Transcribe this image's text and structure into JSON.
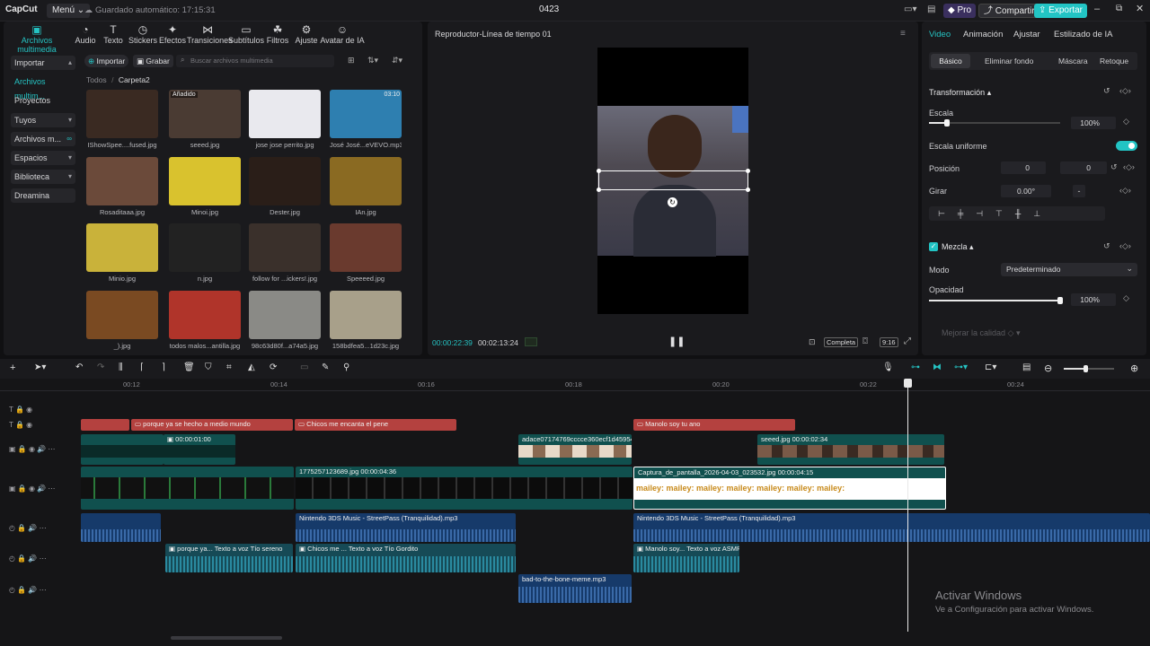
{
  "titlebar": {
    "logo": "CapCut",
    "menu": "Menú",
    "autosave": "Guardado automático: 17:15:31",
    "project": "0423",
    "pro": "Pro",
    "share": "Compartir",
    "export": "Exportar"
  },
  "tools": [
    {
      "label": "Archivos multimedia",
      "icon": "media-icon"
    },
    {
      "label": "Audio",
      "icon": "audio-icon"
    },
    {
      "label": "Texto",
      "icon": "text-icon"
    },
    {
      "label": "Stickers",
      "icon": "sticker-icon"
    },
    {
      "label": "Efectos",
      "icon": "effects-icon"
    },
    {
      "label": "Transiciones",
      "icon": "transitions-icon"
    },
    {
      "label": "Subtítulos",
      "icon": "subtitles-icon"
    },
    {
      "label": "Filtros",
      "icon": "filters-icon"
    },
    {
      "label": "Ajuste",
      "icon": "adjust-icon"
    },
    {
      "label": "Avatar de IA",
      "icon": "avatar-icon"
    }
  ],
  "sidebar": {
    "items": [
      "Importar",
      "Archivos multim...",
      "Proyectos secun...",
      "Tuyos",
      "Archivos m...",
      "Espacios",
      "Biblioteca",
      "Dreamina"
    ]
  },
  "media_toolbar": {
    "import": "Importar",
    "record": "Grabar",
    "search_placeholder": "Buscar archivos multimedia"
  },
  "breadcrumb": {
    "root": "Todos",
    "sep": "/",
    "folder": "Carpeta2"
  },
  "media_items": [
    {
      "name": "IShowSpee....fused.jpg",
      "bg": "#3a2a22"
    },
    {
      "name": "seeed.jpg",
      "bg": "#4a3b33",
      "badge": "Añadido"
    },
    {
      "name": "jose jose perrito.jpg",
      "bg": "#e9e9ee"
    },
    {
      "name": "José José...eVEVO.mp3",
      "bg": "#2e7fb0",
      "duration": "03:10"
    },
    {
      "name": "Rosaditaaa.jpg",
      "bg": "#6b4a3a"
    },
    {
      "name": "Minoi.jpg",
      "bg": "#d9c22e"
    },
    {
      "name": "Dester.jpg",
      "bg": "#2a1e18"
    },
    {
      "name": "IAn.jpg",
      "bg": "#8a6a22"
    },
    {
      "name": "Minio.jpg",
      "bg": "#c9b23a"
    },
    {
      "name": "n.jpg",
      "bg": "#222222"
    },
    {
      "name": "follow for ...ickers!.jpg",
      "bg": "#3a302b"
    },
    {
      "name": "Speeeed.jpg",
      "bg": "#6a3a2e"
    },
    {
      "name": "_).jpg",
      "bg": "#7a4a22"
    },
    {
      "name": "todos malos...antilla.jpg",
      "bg": "#b0342a"
    },
    {
      "name": "98c63d80f...a74a5.jpg",
      "bg": "#8a8a86"
    },
    {
      "name": "158bdfea5...1d23c.jpg",
      "bg": "#a8a08a"
    }
  ],
  "player": {
    "title": "Reproductor-Línea de tiempo 01",
    "current_time": "00:00:22:39",
    "total_time": "00:02:13:24",
    "complete": "Completa",
    "ratio": "9:16"
  },
  "props": {
    "tabs": [
      "Video",
      "Animación",
      "Ajustar",
      "Estilizado de IA"
    ],
    "subtabs": [
      "Básico",
      "Eliminar fondo",
      "Máscara",
      "Retoque"
    ],
    "transform": "Transformación",
    "scale": "Escala",
    "scale_value": "100%",
    "scale_fraction": 0.14,
    "uniform_scale": "Escala uniforme",
    "position": "Posición",
    "x_label": "X",
    "x_value": "0",
    "y_label": "Y",
    "y_value": "0",
    "rotate": "Girar",
    "rotate_value": "0.00°",
    "rotate_mini": "-",
    "blend": "Mezcla",
    "mode": "Modo",
    "mode_value": "Predeterminado",
    "opacity": "Opacidad",
    "opacity_value": "100%",
    "opacity_fraction": 1.0,
    "enhance": "Mejorar la calidad"
  },
  "ruler": [
    "00:12",
    "00:14",
    "00:16",
    "00:18",
    "00:20",
    "00:22",
    "00:24"
  ],
  "clips": {
    "text1": "porque ya se hecho a medio mundo",
    "text2": "Chicos me encanta el pene",
    "text3": "Manolo soy tu ano",
    "overlay_time": "00:00:01:00",
    "overlay_name": "adace07174769cccce360ecf1d45954a.jp",
    "seeed_name": "seeed.jpg",
    "seeed_time": "00:00:02:34",
    "main_name": "1775257123689.jpg",
    "main_time": "00:00:04:36",
    "capture_name": "Captura_de_pantalla_2026-04-03_023532.jpg",
    "capture_time": "00:00:04:15",
    "capture_text": "mailey: mailey: mailey: mailey: mailey: mailey: mailey:",
    "audio1": "Nintendo 3DS Music - StreetPass (Tranquilidad).mp3",
    "audio2": "Nintendo 3DS Music - StreetPass (Tranquilidad).mp3",
    "vo1a": "porque ya...",
    "vo1b": "Texto a voz Tío sereno",
    "vo2a": "Chicos me ...",
    "vo2b": "Texto a voz Tío Gordito",
    "vo3a": "Manolo soy...",
    "vo3b": "Texto a voz ASMR",
    "sfx": "bad-to-the-bone-meme.mp3"
  },
  "watermark": {
    "line1": "Activar Windows",
    "line2": "Ve a Configuración para activar Windows."
  },
  "colors": {
    "accent": "#25c3c3",
    "text_clip": "#b4413f",
    "video_clip": "#10504e",
    "audio_clip": "#163a6a"
  }
}
